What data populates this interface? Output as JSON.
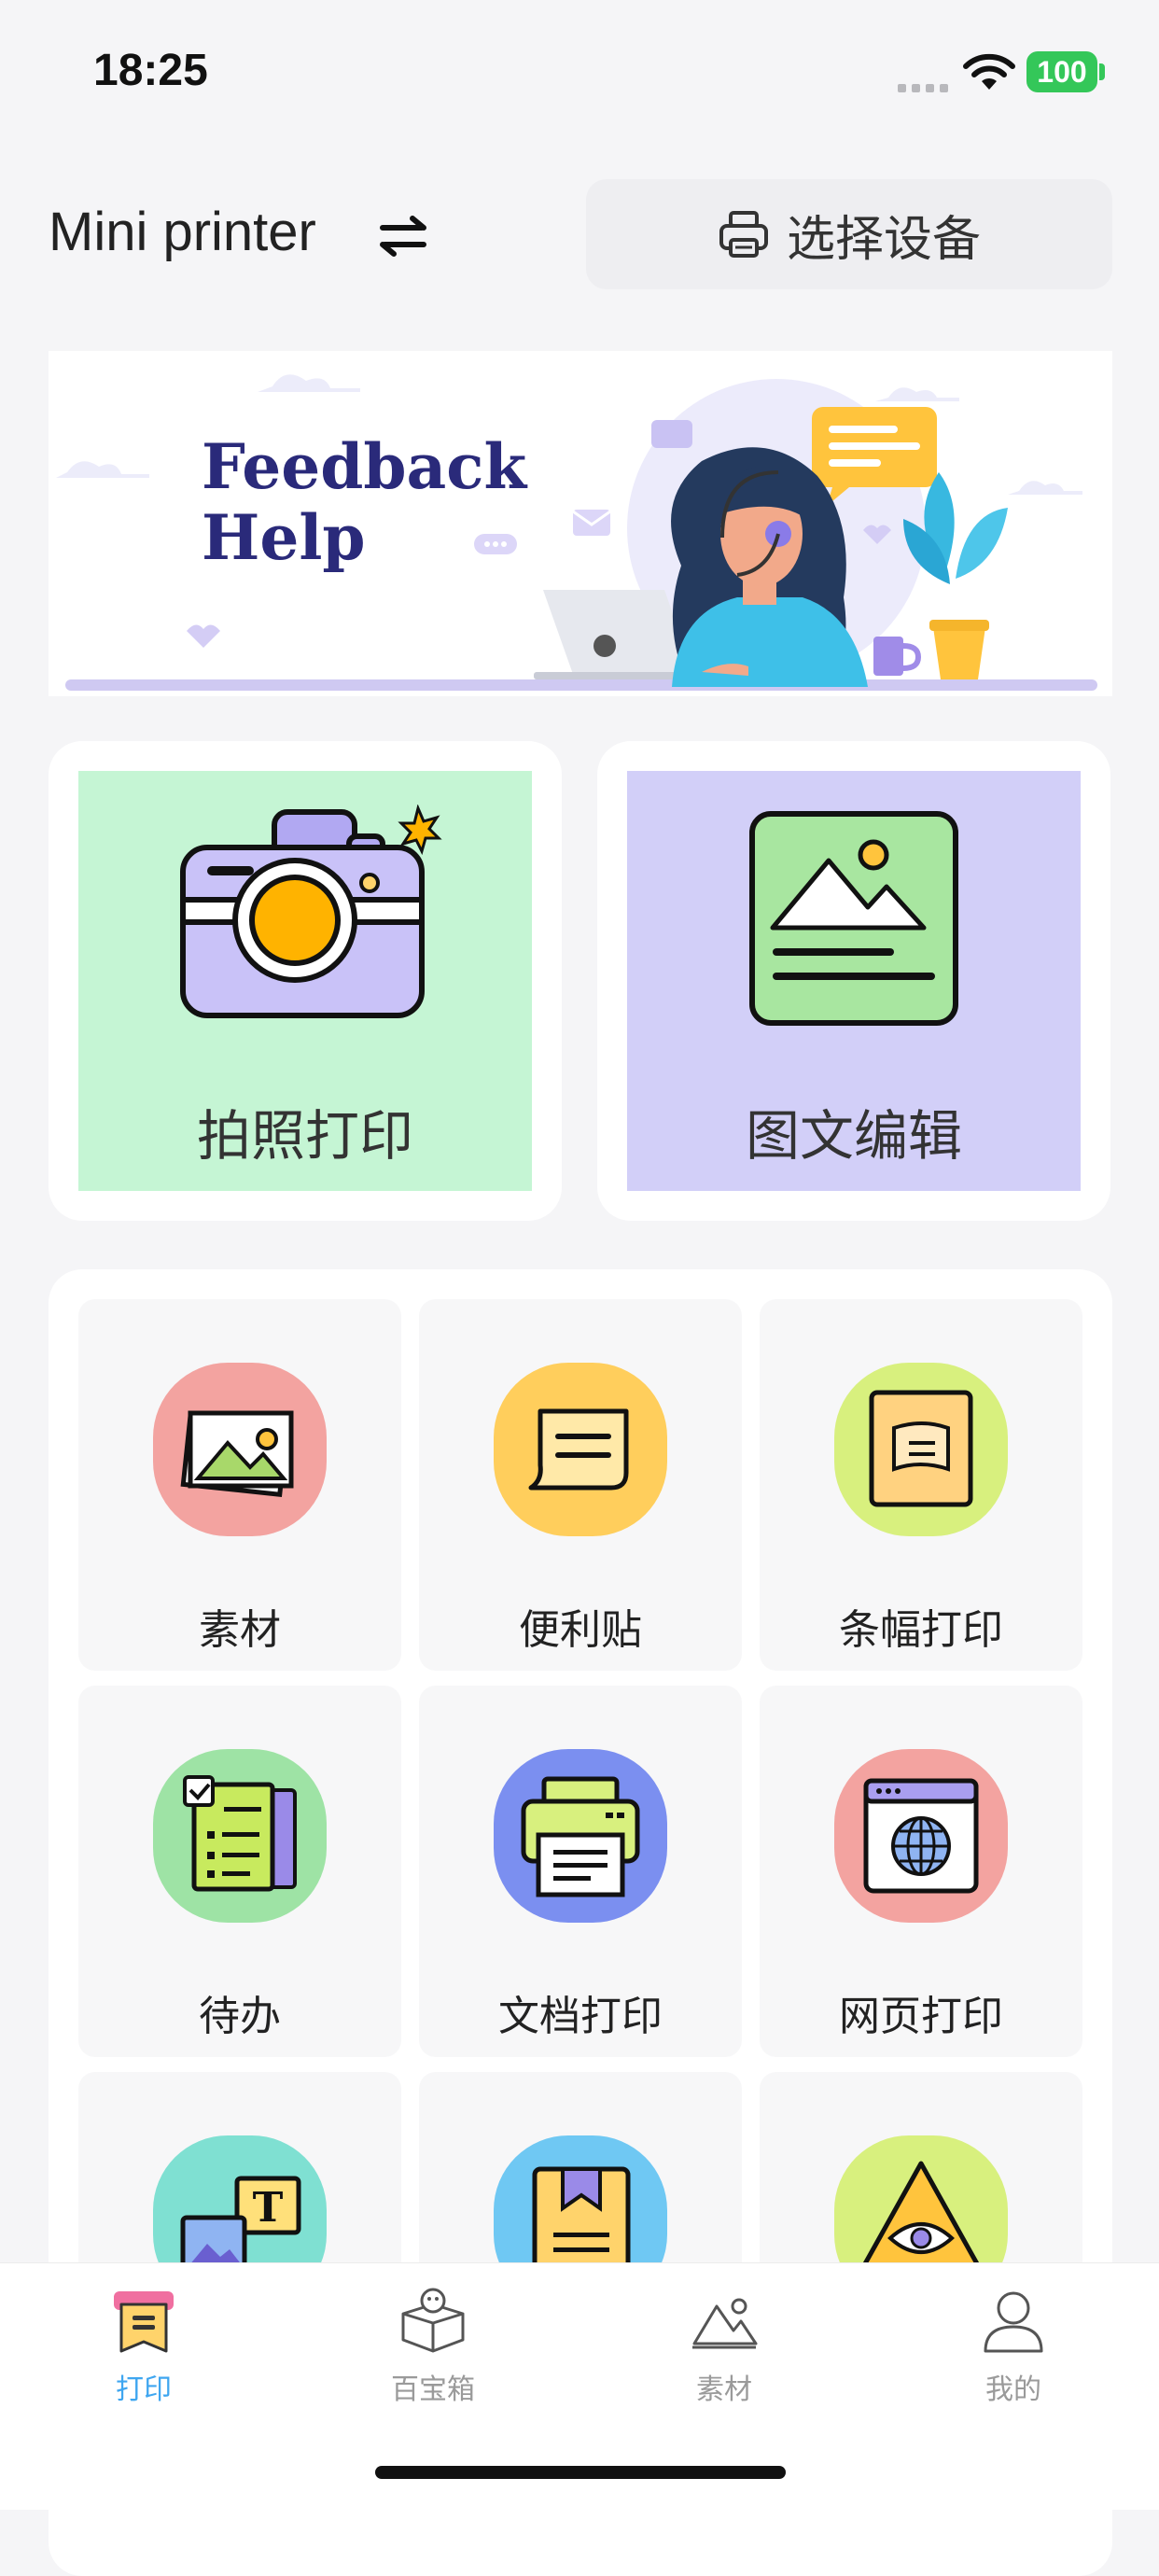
{
  "status_bar": {
    "time": "18:25",
    "battery": "100",
    "icons": [
      "signal-dots-icon",
      "wifi-icon",
      "battery-icon"
    ]
  },
  "header": {
    "title": "Mini printer",
    "switch_icon": "swap-arrows-icon",
    "select_device_label": "选择设备",
    "select_device_icon": "printer-icon"
  },
  "banner": {
    "title": "Feedback\nHelp",
    "illustration": "customer-support-agent-illustration"
  },
  "feature_cards": [
    {
      "label": "拍照打印",
      "icon": "camera-icon",
      "bg": "#c5f5d4"
    },
    {
      "label": "图文编辑",
      "icon": "image-document-icon",
      "bg": "#d2cff8"
    }
  ],
  "grid_items": [
    {
      "label": "素材",
      "icon": "photo-material-icon",
      "bg": "#f3a3a0"
    },
    {
      "label": "便利贴",
      "icon": "sticky-note-icon",
      "bg": "#ffce5c"
    },
    {
      "label": "条幅打印",
      "icon": "banner-print-icon",
      "bg": "#d8f07e"
    },
    {
      "label": "待办",
      "icon": "todo-checklist-icon",
      "bg": "#9ee3a5"
    },
    {
      "label": "文档打印",
      "icon": "document-printer-icon",
      "bg": "#7b8ff0"
    },
    {
      "label": "网页打印",
      "icon": "web-globe-icon",
      "bg": "#f3a3a0"
    },
    {
      "label": "",
      "icon": "text-image-icon",
      "bg": "#7fe0d2"
    },
    {
      "label": "",
      "icon": "bookmark-book-icon",
      "bg": "#6fc8f3"
    },
    {
      "label": "",
      "icon": "eye-triangle-icon",
      "bg": "#d8f07e"
    }
  ],
  "tab_bar": {
    "active_color": "#3fa6f0",
    "tabs": [
      {
        "label": "打印",
        "icon": "print-tab-icon",
        "active": true
      },
      {
        "label": "百宝箱",
        "icon": "treasure-box-icon",
        "active": false
      },
      {
        "label": "素材",
        "icon": "mountain-image-icon",
        "active": false
      },
      {
        "label": "我的",
        "icon": "person-icon",
        "active": false
      }
    ]
  }
}
